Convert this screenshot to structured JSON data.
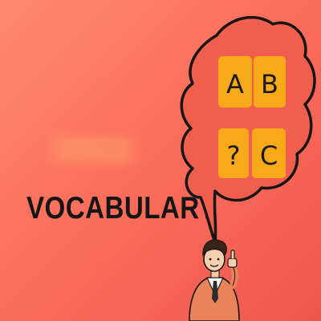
{
  "title": "VOCABULARY",
  "tiles": [
    "A",
    "B",
    "?",
    "C"
  ],
  "colors": {
    "background": "#f66a58",
    "tile": "#f7a919",
    "bubble": "#f05e4e",
    "ink": "#161616"
  }
}
